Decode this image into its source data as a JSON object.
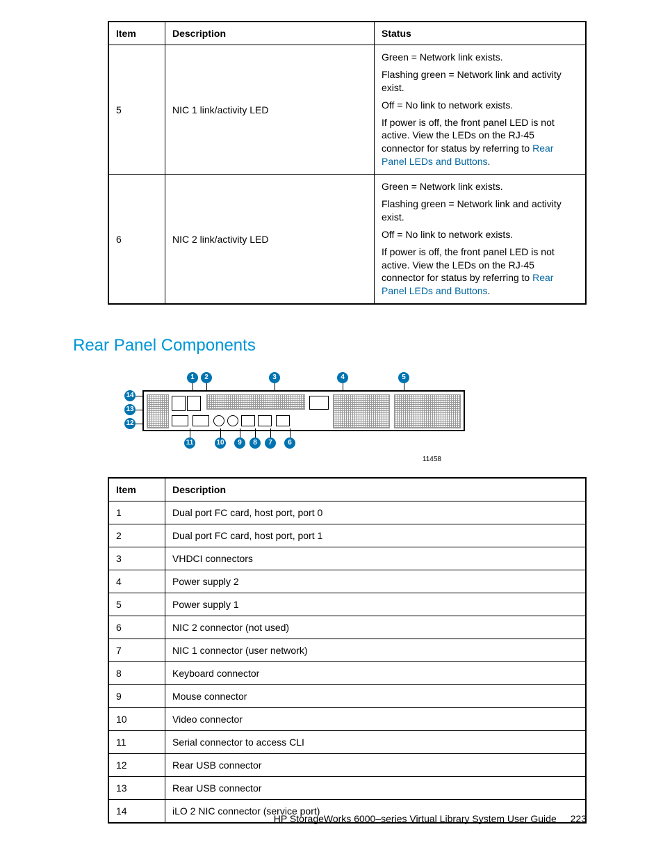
{
  "table1": {
    "headers": {
      "item": "Item",
      "description": "Description",
      "status": "Status"
    },
    "rows": [
      {
        "item": "5",
        "description": "NIC 1 link/activity LED",
        "status_l1": "Green = Network link exists.",
        "status_l2": "Flashing green = Network link and activity exist.",
        "status_l3": "Off = No link to network exists.",
        "status_l4a": "If power is off, the front panel LED is not active. View the LEDs on the RJ-45 connector for status by referring to ",
        "status_link": "Rear Panel LEDs and Buttons",
        "status_l4b": "."
      },
      {
        "item": "6",
        "description": "NIC 2 link/activity LED",
        "status_l1": "Green = Network link exists.",
        "status_l2": "Flashing green = Network link and activity exist.",
        "status_l3": "Off = No link to network exists.",
        "status_l4a": "If power is off, the front panel LED is not active. View the LEDs on the RJ-45 connector for status by referring to ",
        "status_link": "Rear Panel LEDs and Buttons",
        "status_l4b": "."
      }
    ]
  },
  "heading": "Rear Panel Components",
  "diagram_id": "11458",
  "callouts": [
    "1",
    "2",
    "3",
    "4",
    "5",
    "6",
    "7",
    "8",
    "9",
    "10",
    "11",
    "12",
    "13",
    "14"
  ],
  "table2": {
    "headers": {
      "item": "Item",
      "description": "Description"
    },
    "rows": [
      {
        "item": "1",
        "description": "Dual port FC card, host port, port 0"
      },
      {
        "item": "2",
        "description": "Dual port FC card, host port, port 1"
      },
      {
        "item": "3",
        "description": "VHDCI connectors"
      },
      {
        "item": "4",
        "description": "Power supply 2"
      },
      {
        "item": "5",
        "description": "Power supply 1"
      },
      {
        "item": "6",
        "description": "NIC 2 connector (not used)"
      },
      {
        "item": "7",
        "description": "NIC 1 connector (user network)"
      },
      {
        "item": "8",
        "description": "Keyboard connector"
      },
      {
        "item": "9",
        "description": "Mouse connector"
      },
      {
        "item": "10",
        "description": "Video connector"
      },
      {
        "item": "11",
        "description": "Serial connector to access CLI"
      },
      {
        "item": "12",
        "description": "Rear USB connector"
      },
      {
        "item": "13",
        "description": "Rear USB connector"
      },
      {
        "item": "14",
        "description": "iLO 2 NIC connector (service port)"
      }
    ]
  },
  "footer": {
    "title": "HP StorageWorks 6000–series Virtual Library System User Guide",
    "page": "223"
  }
}
